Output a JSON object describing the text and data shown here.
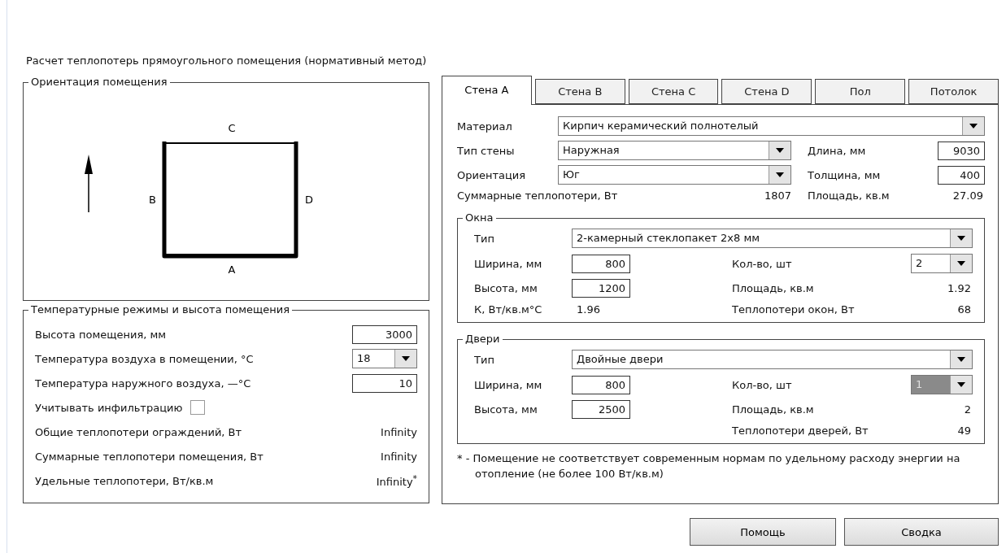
{
  "title": "Расчет теплопотерь прямоугольного помещения (нормативный метод)",
  "orientation": {
    "legend": "Ориентация помещения",
    "wall_labels": {
      "top": "C",
      "left": "B",
      "right": "D",
      "bottom": "A"
    }
  },
  "temperature": {
    "legend": "Температурные режимы и высота помещения",
    "rows": [
      {
        "kind": "input",
        "label": "Высота помещения, мм",
        "value": "3000"
      },
      {
        "kind": "select",
        "label": "Температура воздуха в помещении, °C",
        "value": "18"
      },
      {
        "kind": "input",
        "label": "Температура наружного воздуха, —°C",
        "value": "10"
      },
      {
        "kind": "checkbox",
        "label": "Учитывать инфильтрацию",
        "checked": false
      },
      {
        "kind": "readout",
        "label": "Общие теплопотери ограждений, Вт",
        "value": "Infinity"
      },
      {
        "kind": "readout",
        "label": "Суммарные теплопотери помещения, Вт",
        "value": "Infinity"
      },
      {
        "kind": "readout",
        "label": "Удельные теплопотери, Вт/кв.м",
        "value": "Infinity$^{*}$"
      }
    ]
  },
  "tabs": [
    {
      "label": "Стена A",
      "selected": true
    },
    {
      "label": "Стена B",
      "selected": false
    },
    {
      "label": "Стена C",
      "selected": false
    },
    {
      "label": "Стена D",
      "selected": false
    },
    {
      "label": "Пол",
      "selected": false
    },
    {
      "label": "Потолок",
      "selected": false
    }
  ],
  "wall": {
    "material": {
      "label": "Материал",
      "value": "Кирпич керамический полнотелый"
    },
    "type": {
      "label": "Тип стены",
      "value": "Наружная"
    },
    "length": {
      "label": "Длина, мм",
      "value": "9030"
    },
    "orientation": {
      "label": "Ориентация",
      "value": "Юг"
    },
    "thickness": {
      "label": "Толщина, мм",
      "value": "400"
    },
    "total_loss": {
      "label": "Суммарные теплопотери, Вт",
      "value": "1807"
    },
    "area": {
      "label": "Площадь, кв.м",
      "value": "27.09"
    }
  },
  "windows": {
    "legend": "Окна",
    "type": {
      "label": "Тип",
      "value": "2-камерный стеклопакет 2х8 мм"
    },
    "width": {
      "label": "Ширина, мм",
      "value": "800"
    },
    "count": {
      "label": "Кол-во, шт",
      "value": "2",
      "disabled": false
    },
    "height": {
      "label": "Высота, мм",
      "value": "1200"
    },
    "area": {
      "label": "Площадь, кв.м",
      "value": "1.92"
    },
    "k": {
      "label": "К, Вт/кв.м°C",
      "value": "1.96"
    },
    "loss": {
      "label": "Теплопотери окон, Вт",
      "value": "68"
    }
  },
  "doors": {
    "legend": "Двери",
    "type": {
      "label": "Тип",
      "value": "Двойные двери"
    },
    "width": {
      "label": "Ширина, мм",
      "value": "800"
    },
    "count": {
      "label": "Кол-во, шт",
      "value": "1",
      "disabled": true
    },
    "height": {
      "label": "Высота, мм",
      "value": "2500"
    },
    "area": {
      "label": "Площадь, кв.м",
      "value": "2"
    },
    "loss": {
      "label": "Теплопотери дверей, Вт",
      "value": "49"
    }
  },
  "note": "* - Помещение не соответствует современным нормам по удельному расходу энергии на отопление (не более 100 Вт/кв.м)",
  "buttons": [
    "Помощь",
    "Сводка"
  ]
}
